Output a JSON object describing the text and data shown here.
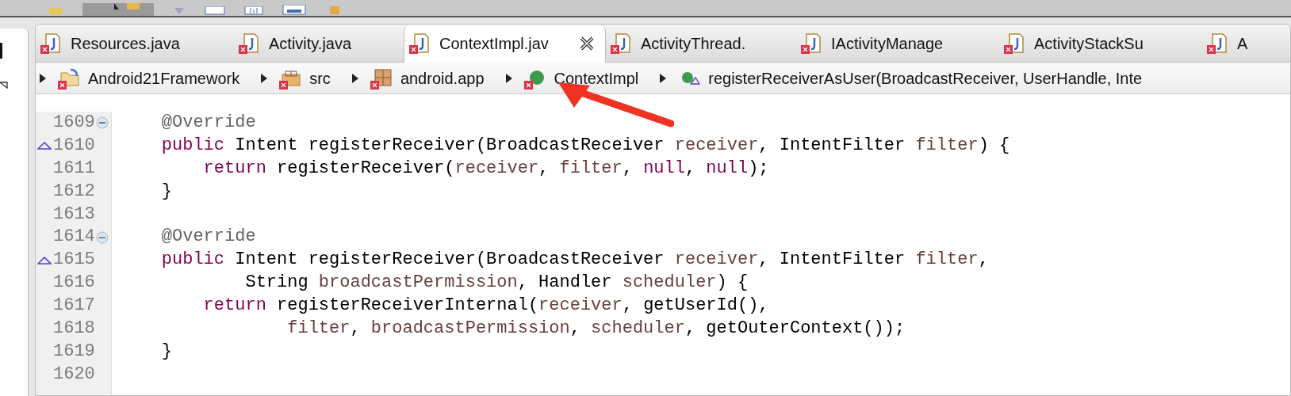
{
  "tabs": [
    {
      "label": "Resources.java",
      "selected": false
    },
    {
      "label": "Activity.java",
      "selected": false
    },
    {
      "label": "ContextImpl.jav",
      "selected": true
    },
    {
      "label": "ActivityThread.",
      "selected": false
    },
    {
      "label": "IActivityManage",
      "selected": false
    },
    {
      "label": "ActivityStackSu",
      "selected": false
    },
    {
      "label": "A",
      "selected": false
    }
  ],
  "breadcrumb": [
    {
      "kind": "project",
      "label": "Android21Framework"
    },
    {
      "kind": "folder",
      "label": "src"
    },
    {
      "kind": "package",
      "label": "android.app"
    },
    {
      "kind": "class",
      "label": "ContextImpl"
    },
    {
      "kind": "method",
      "label": "registerReceiverAsUser(BroadcastReceiver, UserHandle, Inte"
    }
  ],
  "code_lines": [
    {
      "number": "1609",
      "foldable": true,
      "override": false,
      "tokens": [
        {
          "kind": "annotation",
          "text": "    @Override"
        }
      ]
    },
    {
      "number": "1610",
      "foldable": false,
      "override": true,
      "tokens": [
        {
          "kind": "keyword",
          "text": "    public"
        },
        {
          "kind": "plain",
          "text": " Intent registerReceiver(BroadcastReceiver "
        },
        {
          "kind": "variable",
          "text": "receiver"
        },
        {
          "kind": "plain",
          "text": ", IntentFilter "
        },
        {
          "kind": "variable",
          "text": "filter"
        },
        {
          "kind": "plain",
          "text": ") {"
        }
      ]
    },
    {
      "number": "1611",
      "foldable": false,
      "override": false,
      "tokens": [
        {
          "kind": "keyword",
          "text": "        return"
        },
        {
          "kind": "plain",
          "text": " registerReceiver("
        },
        {
          "kind": "variable",
          "text": "receiver"
        },
        {
          "kind": "plain",
          "text": ", "
        },
        {
          "kind": "variable",
          "text": "filter"
        },
        {
          "kind": "plain",
          "text": ", "
        },
        {
          "kind": "keyword",
          "text": "null"
        },
        {
          "kind": "plain",
          "text": ", "
        },
        {
          "kind": "keyword",
          "text": "null"
        },
        {
          "kind": "plain",
          "text": ");"
        }
      ]
    },
    {
      "number": "1612",
      "foldable": false,
      "override": false,
      "tokens": [
        {
          "kind": "plain",
          "text": "    }"
        }
      ]
    },
    {
      "number": "1613",
      "foldable": false,
      "override": false
    },
    {
      "number": "1614",
      "foldable": true,
      "override": false,
      "tokens": [
        {
          "kind": "annotation",
          "text": "    @Override"
        }
      ]
    },
    {
      "number": "1615",
      "foldable": false,
      "override": true,
      "tokens": [
        {
          "kind": "keyword",
          "text": "    public"
        },
        {
          "kind": "plain",
          "text": " Intent registerReceiver(BroadcastReceiver "
        },
        {
          "kind": "variable",
          "text": "receiver"
        },
        {
          "kind": "plain",
          "text": ", IntentFilter "
        },
        {
          "kind": "variable",
          "text": "filter"
        },
        {
          "kind": "plain",
          "text": ","
        }
      ]
    },
    {
      "number": "1616",
      "foldable": false,
      "override": false,
      "tokens": [
        {
          "kind": "plain",
          "text": "            String "
        },
        {
          "kind": "variable",
          "text": "broadcastPermission"
        },
        {
          "kind": "plain",
          "text": ", Handler "
        },
        {
          "kind": "variable",
          "text": "scheduler"
        },
        {
          "kind": "plain",
          "text": ") {"
        }
      ]
    },
    {
      "number": "1617",
      "foldable": false,
      "override": false,
      "tokens": [
        {
          "kind": "keyword",
          "text": "        return"
        },
        {
          "kind": "plain",
          "text": " registerReceiverInternal("
        },
        {
          "kind": "variable",
          "text": "receiver"
        },
        {
          "kind": "plain",
          "text": ", getUserId(),"
        }
      ]
    },
    {
      "number": "1618",
      "foldable": false,
      "override": false,
      "tokens": [
        {
          "kind": "variable",
          "text": "                filter"
        },
        {
          "kind": "plain",
          "text": ", "
        },
        {
          "kind": "variable",
          "text": "broadcastPermission"
        },
        {
          "kind": "plain",
          "text": ", "
        },
        {
          "kind": "variable",
          "text": "scheduler"
        },
        {
          "kind": "plain",
          "text": ", getOuterContext());"
        }
      ]
    },
    {
      "number": "1619",
      "foldable": false,
      "override": false,
      "tokens": [
        {
          "kind": "plain",
          "text": "    }"
        }
      ]
    },
    {
      "number": "1620",
      "foldable": false,
      "override": false
    }
  ]
}
